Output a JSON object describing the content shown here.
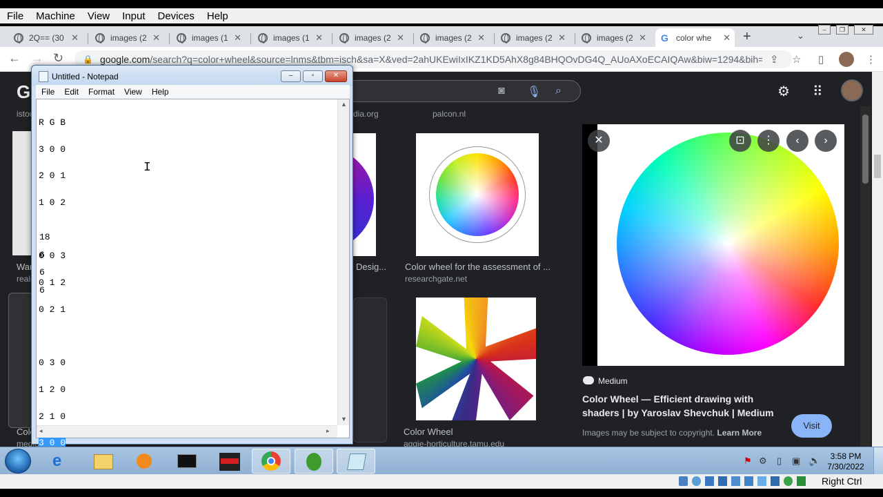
{
  "vm_menu": [
    "File",
    "Machine",
    "View",
    "Input",
    "Devices",
    "Help"
  ],
  "tabs": [
    {
      "label": "2Q== (30",
      "active": false
    },
    {
      "label": "images (2",
      "active": false
    },
    {
      "label": "images (1",
      "active": false
    },
    {
      "label": "images (1",
      "active": false
    },
    {
      "label": "images (2",
      "active": false
    },
    {
      "label": "images (2",
      "active": false
    },
    {
      "label": "images (2",
      "active": false
    },
    {
      "label": "images (2",
      "active": false
    },
    {
      "label": "color whe",
      "active": true
    }
  ],
  "address": {
    "domain": "google.com",
    "path": "/search?q=color+wheel&source=lnms&tbm=isch&sa=X&ved=2ahUKEwiIxIKZ1KD5AhX8g84BHQOvDG4Q_AUoAXoECAIQAw&biw=1294&bih=5..."
  },
  "google": {
    "partial_sources": [
      "istoc",
      "dia.org",
      "palcon.nl"
    ],
    "left_partial": {
      "title": "War",
      "source": "realm",
      "title2": "Colo",
      "source2": "medium.com"
    },
    "results": [
      {
        "title": "Desig...",
        "source": ""
      },
      {
        "title": "Color wheel for the assessment of ...",
        "source": "researchgate.net"
      },
      {
        "title": "Color Wheel",
        "source": "aggie-horticulture.tamu.edu"
      }
    ],
    "preview": {
      "site": "Medium",
      "title": "Color Wheel — Efficient drawing with shaders | by Yaroslav Shevchuk | Medium",
      "copyright": "Images may be subject to copyright.",
      "learn_more": "Learn More",
      "visit": "Visit"
    }
  },
  "notepad": {
    "title": "Untitled - Notepad",
    "menu": [
      "File",
      "Edit",
      "Format",
      "View",
      "Help"
    ],
    "lines": [
      "R G B",
      "3 0 0",
      "2 0 1",
      "1 0 2",
      "",
      "0 0 3",
      "0 1 2",
      "0 2 1",
      "",
      "0 3 0",
      "1 2 0",
      "2 1 0"
    ],
    "selected_line": "3 0 0",
    "numbers": [
      "18",
      "6",
      "6",
      "6"
    ]
  },
  "tray": {
    "time": "3:58 PM",
    "date": "7/30/2022"
  },
  "vm_status": {
    "host_key": "Right Ctrl"
  },
  "icons": [
    "globe-icon",
    "google-g-icon",
    "reload-icon",
    "lock-icon",
    "share-icon",
    "star-icon",
    "camera-icon",
    "mic-icon",
    "search-icon",
    "gear-icon",
    "apps-icon",
    "close-icon",
    "lens-icon",
    "more-icon",
    "prev-icon",
    "next-icon"
  ]
}
